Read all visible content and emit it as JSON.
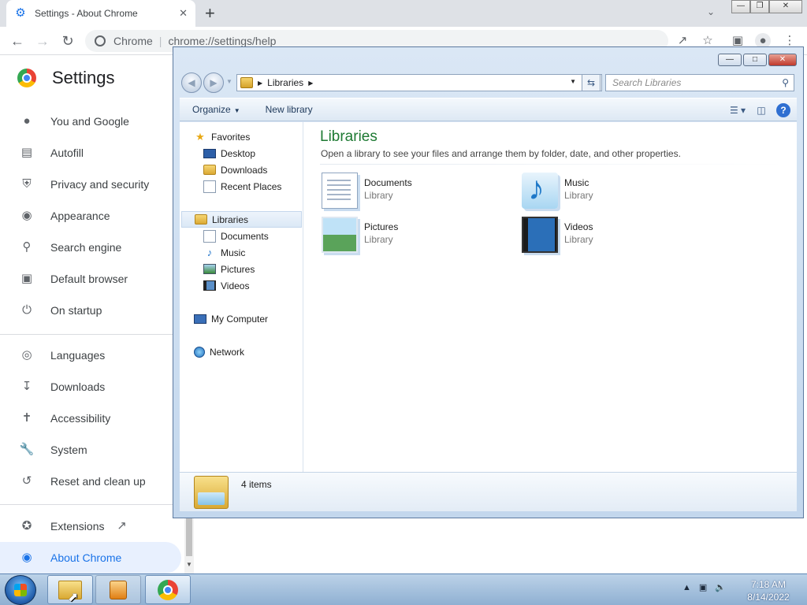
{
  "chrome": {
    "tab_title": "Settings - About Chrome",
    "omnibox_site": "Chrome",
    "omnibox_url": "chrome://settings/help",
    "settings_title": "Settings",
    "nav": [
      {
        "label": "You and Google",
        "icon": "person-icon"
      },
      {
        "label": "Autofill",
        "icon": "clipboard-icon"
      },
      {
        "label": "Privacy and security",
        "icon": "shield-icon"
      },
      {
        "label": "Appearance",
        "icon": "palette-icon"
      },
      {
        "label": "Search engine",
        "icon": "search-icon"
      },
      {
        "label": "Default browser",
        "icon": "browser-icon"
      },
      {
        "label": "On startup",
        "icon": "power-icon"
      },
      {
        "label": "Languages",
        "icon": "globe-icon"
      },
      {
        "label": "Downloads",
        "icon": "download-icon"
      },
      {
        "label": "Accessibility",
        "icon": "accessibility-icon"
      },
      {
        "label": "System",
        "icon": "wrench-icon"
      },
      {
        "label": "Reset and clean up",
        "icon": "history-icon"
      },
      {
        "label": "Extensions",
        "icon": "puzzle-icon"
      },
      {
        "label": "About Chrome",
        "icon": "chrome-icon"
      }
    ]
  },
  "explorer": {
    "breadcrumb": "Libraries",
    "search_placeholder": "Search Libraries",
    "organize_label": "Organize",
    "new_library_label": "New library",
    "nav_pane": {
      "favorites": "Favorites",
      "desktop": "Desktop",
      "downloads": "Downloads",
      "recent_places": "Recent Places",
      "libraries": "Libraries",
      "documents": "Documents",
      "music": "Music",
      "pictures": "Pictures",
      "videos": "Videos",
      "my_computer": "My Computer",
      "network": "Network"
    },
    "heading": "Libraries",
    "description": "Open a library to see your files and arrange them by folder, date, and other properties.",
    "libraries": [
      {
        "name": "Documents",
        "type": "Library"
      },
      {
        "name": "Music",
        "type": "Library"
      },
      {
        "name": "Pictures",
        "type": "Library"
      },
      {
        "name": "Videos",
        "type": "Library"
      }
    ],
    "status": "4 items"
  },
  "taskbar": {
    "time": "7:18 AM",
    "date": "8/14/2022"
  }
}
